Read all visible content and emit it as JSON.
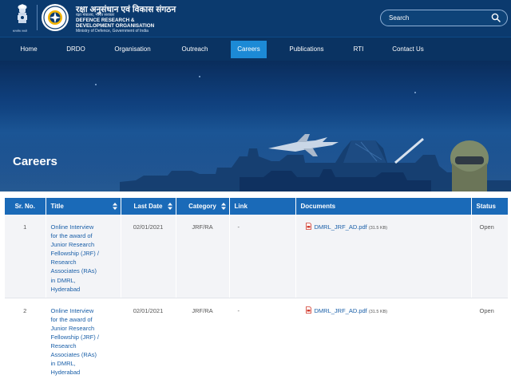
{
  "header": {
    "emblem_caption": "सत्यमेव जयते",
    "org_name_hindi": "रक्षा अनुसंधान एवं विकास संगठन",
    "ministry_hindi": "रक्षा मंत्रालय, भारत सरकार",
    "org_name_en_line1": "DEFENCE RESEARCH &",
    "org_name_en_line2": "DEVELOPMENT ORGANISATION",
    "ministry_en": "Ministry of Defence, Government of India",
    "search_placeholder": "Search"
  },
  "nav": {
    "items": [
      {
        "label": "Home",
        "active": false
      },
      {
        "label": "DRDO",
        "active": false
      },
      {
        "label": "Organisation",
        "active": false
      },
      {
        "label": "Outreach",
        "active": false
      },
      {
        "label": "Careers",
        "active": true
      },
      {
        "label": "Publications",
        "active": false
      },
      {
        "label": "RTI",
        "active": false
      },
      {
        "label": "Contact Us",
        "active": false
      }
    ]
  },
  "banner": {
    "title": "Careers"
  },
  "table": {
    "columns": [
      "Sr. No.",
      "Title",
      "Last Date",
      "Category",
      "Link",
      "Documents",
      "Status"
    ],
    "rows": [
      {
        "sr_no": "1",
        "title_lines": [
          "Online Interview",
          "for the award of",
          "Junior Research",
          "Fellowship (JRF) /",
          "Research",
          "Associates (RAs)",
          "in DMRL,",
          "Hyderabad"
        ],
        "last_date": "02/01/2021",
        "category": "JRF/RA",
        "link": "-",
        "document_name": "DMRL_JRF_AD.pdf",
        "document_size": "(31.5 KB)",
        "status": "Open"
      },
      {
        "sr_no": "2",
        "title_lines": [
          "Online Interview",
          "for the award of",
          "Junior Research",
          "Fellowship (JRF) /",
          "Research",
          "Associates (RAs)",
          "in DMRL,",
          "Hyderabad"
        ],
        "last_date": "02/01/2021",
        "category": "JRF/RA",
        "link": "-",
        "document_name": "DMRL_JRF_AD.pdf",
        "document_size": "(31.5 KB)",
        "status": "Open"
      }
    ]
  },
  "colors": {
    "header_bg": "#0b3a6e",
    "nav_bg": "#0a3362",
    "nav_active": "#1c8ad6",
    "table_header": "#1a6ab8",
    "link": "#1a5fa8"
  }
}
